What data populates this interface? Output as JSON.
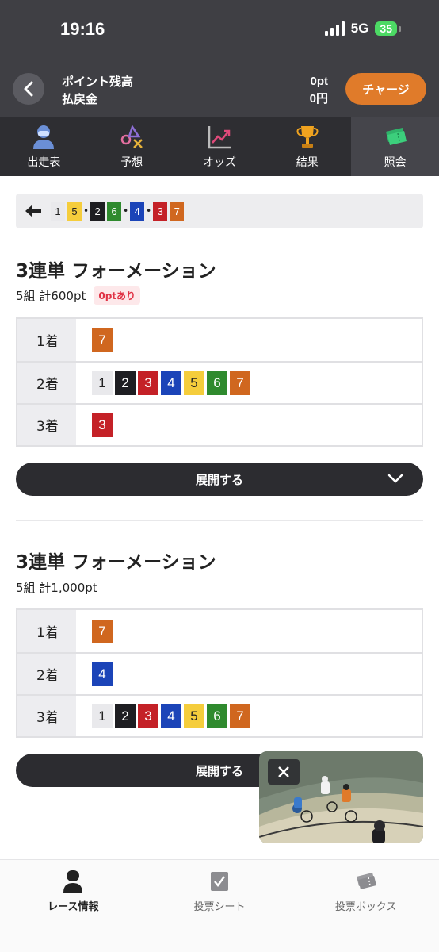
{
  "status": {
    "time": "19:16",
    "network": "5G",
    "battery": "35"
  },
  "header": {
    "balance_label": "ポイント残高",
    "payout_label": "払戻金",
    "balance_value": "0pt",
    "payout_value": "0円",
    "charge_label": "チャージ"
  },
  "tabs": [
    {
      "label": "出走表",
      "icon": "racer-icon"
    },
    {
      "label": "予想",
      "icon": "prediction-icon"
    },
    {
      "label": "オッズ",
      "icon": "odds-chart-icon"
    },
    {
      "label": "結果",
      "icon": "trophy-icon"
    },
    {
      "label": "照会",
      "icon": "ticket-icon",
      "active": true
    }
  ],
  "breadcrumb": {
    "line": [
      {
        "num": "1"
      },
      {
        "num": "5"
      },
      {
        "sep": "•"
      },
      {
        "num": "2"
      },
      {
        "num": "6"
      },
      {
        "sep": "•"
      },
      {
        "num": "4"
      },
      {
        "sep": "•"
      },
      {
        "num": "3"
      },
      {
        "num": "7"
      }
    ]
  },
  "colors": {
    "1": {
      "bg": "#e9e9ec",
      "fg": "#222222"
    },
    "2": {
      "bg": "#1e1e22",
      "fg": "#ffffff"
    },
    "3": {
      "bg": "#c42127",
      "fg": "#ffffff"
    },
    "4": {
      "bg": "#1b44b8",
      "fg": "#ffffff"
    },
    "5": {
      "bg": "#f5cd3c",
      "fg": "#222222"
    },
    "6": {
      "bg": "#2f8a2e",
      "fg": "#ffffff"
    },
    "7": {
      "bg": "#d0671f",
      "fg": "#ffffff"
    },
    "accent": "#e07b2a"
  },
  "bets": [
    {
      "title": "3連単 フォーメーション",
      "summary": "5組 計600pt",
      "badge": "0ptあり",
      "rows": [
        {
          "label": "1着",
          "nums": [
            "7"
          ]
        },
        {
          "label": "2着",
          "nums": [
            "1",
            "2",
            "3",
            "4",
            "5",
            "6",
            "7"
          ]
        },
        {
          "label": "3着",
          "nums": [
            "3"
          ]
        }
      ],
      "expand_label": "展開する"
    },
    {
      "title": "3連単 フォーメーション",
      "summary": "5組 計1,000pt",
      "rows": [
        {
          "label": "1着",
          "nums": [
            "7"
          ]
        },
        {
          "label": "2着",
          "nums": [
            "4"
          ]
        },
        {
          "label": "3着",
          "nums": [
            "1",
            "2",
            "3",
            "4",
            "5",
            "6",
            "7"
          ]
        }
      ],
      "expand_label": "展開する"
    }
  ],
  "bottom_nav": [
    {
      "label": "レース情報",
      "icon": "race-info-icon",
      "active": true
    },
    {
      "label": "投票シート",
      "icon": "vote-sheet-icon"
    },
    {
      "label": "投票ボックス",
      "icon": "vote-box-icon"
    }
  ]
}
